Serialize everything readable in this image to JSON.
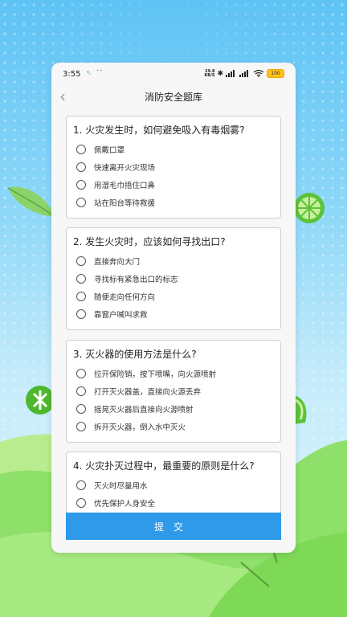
{
  "status_bar": {
    "time": "3:55",
    "net_speed_value": "29.8",
    "net_speed_unit": "KB/S",
    "battery": "100"
  },
  "header": {
    "title": "消防安全题库"
  },
  "questions": [
    {
      "title": "1. 火灾发生时，如何避免吸入有毒烟雾?",
      "options": [
        "佩戴口罩",
        "快速离开火灾现场",
        "用湿毛巾捂住口鼻",
        "站在阳台等待救援"
      ]
    },
    {
      "title": "2. 发生火灾时，应该如何寻找出口?",
      "options": [
        "直接奔向大门",
        "寻找标有紧急出口的标志",
        "随便走向任何方向",
        "靠窗户喊叫求救"
      ]
    },
    {
      "title": "3. 灭火器的使用方法是什么?",
      "options": [
        "拉开保险销，按下喷嘴，向火源喷射",
        "打开灭火器盖，直接向火源丢弃",
        "摇晃灭火器后直接向火源喷射",
        "拆开灭火器，倒入水中灭火"
      ]
    },
    {
      "title": "4. 火灾扑灭过程中，最重要的原则是什么?",
      "options": [
        "灭火时尽量用水",
        "优先保护人身安全"
      ]
    }
  ],
  "submit_label": "提交",
  "colors": {
    "primary": "#2f9ae9",
    "background_sky": "#5ec3f5",
    "hills": "#7ed957"
  }
}
